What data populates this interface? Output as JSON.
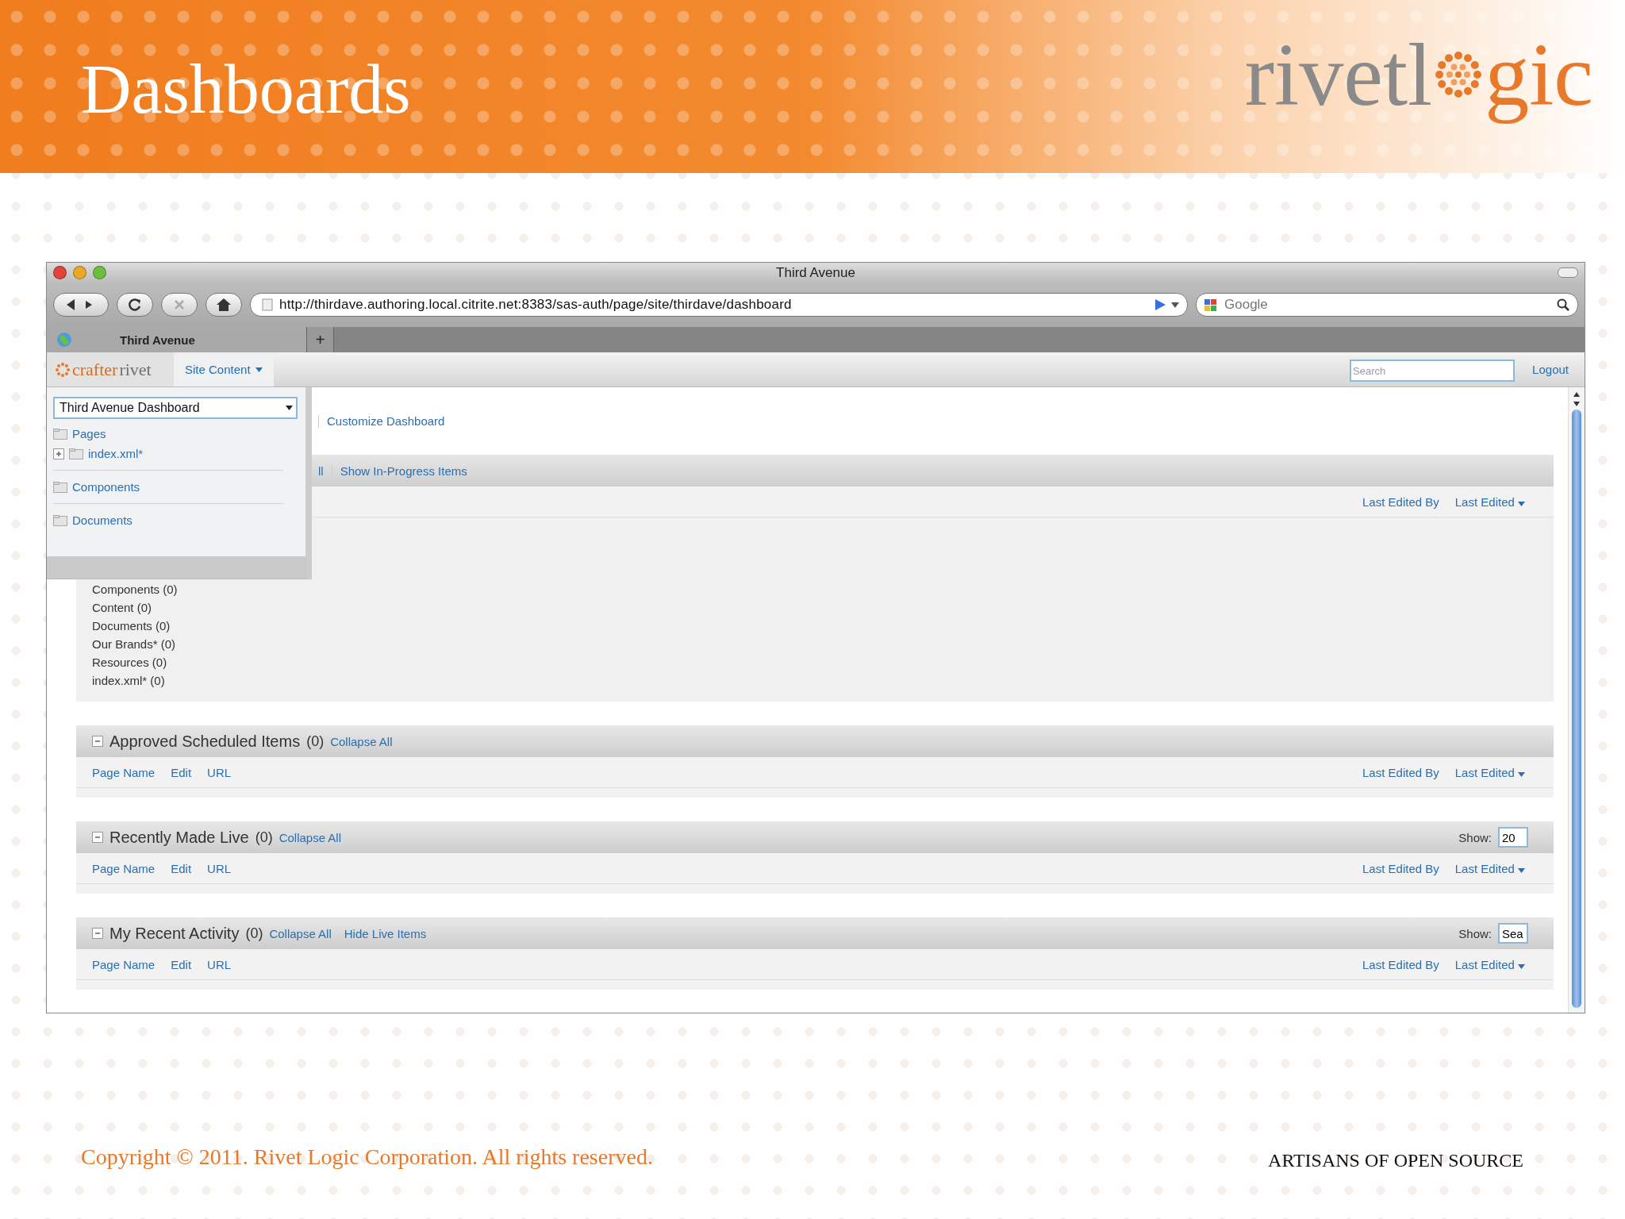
{
  "slide": {
    "title": "Dashboards",
    "logo_start": "rivetl",
    "logo_end": "gic",
    "copyright": "Copyright © 2011. Rivet Logic Corporation. All rights reserved.",
    "tagline": "ARTISANS OF OPEN SOURCE"
  },
  "browser": {
    "title": "Third Avenue",
    "url": "http://thirdave.authoring.local.citrite.net:8383/sas-auth/page/site/thirdave/dashboard",
    "search_placeholder": "Google",
    "new_tab": "+",
    "tabs": [
      {
        "label": "Third Avenue",
        "selected": true
      }
    ]
  },
  "app": {
    "brand": [
      "crafter",
      "rivet"
    ],
    "search_placeholder": "Search",
    "logout": "Logout",
    "menu": [
      {
        "label": "Site Content",
        "expanded": true
      }
    ]
  },
  "site_menu": {
    "dashboard_select": "Third Avenue Dashboard",
    "items": [
      {
        "label": "Pages",
        "children": [
          {
            "label": "index.xml*",
            "expanded": false
          }
        ]
      },
      {
        "label": "Components"
      },
      {
        "label": "Documents"
      }
    ]
  },
  "top": {
    "link": "Customize Dashboard",
    "bar_links": [
      "ll",
      "Show In-Progress Items"
    ],
    "columns_right": [
      {
        "label": "Last Edited By",
        "sorted": false
      },
      {
        "label": "Last Edited",
        "sorted": true
      }
    ]
  },
  "filters": [
    "Components (0)",
    "Content (0)",
    "Documents (0)",
    "Our Brands* (0)",
    "Resources (0)",
    "index.xml* (0)"
  ],
  "sections": [
    {
      "title": "Approved Scheduled Items",
      "count": "(0)",
      "expanded": true,
      "links": [
        "Collapse All"
      ],
      "columns_left": [
        "Page Name",
        "Edit",
        "URL"
      ],
      "columns_right": [
        {
          "label": "Last Edited By",
          "sorted": false
        },
        {
          "label": "Last Edited",
          "sorted": true
        }
      ]
    },
    {
      "title": "Recently Made Live",
      "count": "(0)",
      "expanded": true,
      "links": [
        "Collapse All"
      ],
      "show": {
        "label": "Show:",
        "value": "20"
      },
      "columns_left": [
        "Page Name",
        "Edit",
        "URL"
      ],
      "columns_right": [
        {
          "label": "Last Edited By",
          "sorted": false
        },
        {
          "label": "Last Edited",
          "sorted": true
        }
      ]
    },
    {
      "title": "My Recent Activity",
      "count": "(0)",
      "expanded": true,
      "links": [
        "Collapse All",
        "Hide Live Items"
      ],
      "show": {
        "label": "Show:",
        "value": "Sea"
      },
      "columns_left": [
        "Page Name",
        "Edit",
        "URL"
      ],
      "columns_right": [
        {
          "label": "Last Edited By",
          "sorted": false
        },
        {
          "label": "Last Edited",
          "sorted": true
        }
      ]
    }
  ]
}
